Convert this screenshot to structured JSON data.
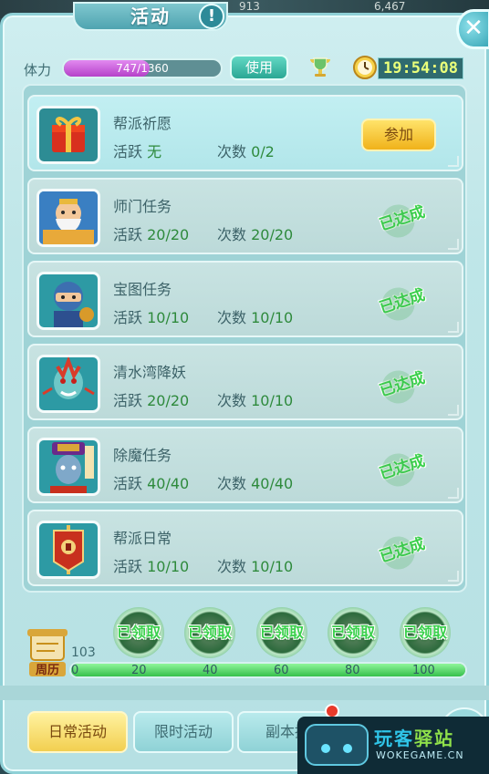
{
  "backdrop": {
    "left_stat": "913",
    "right_stat": "6,467"
  },
  "header": {
    "title": "活动",
    "alert_symbol": "!",
    "close_symbol": "✕"
  },
  "stamina": {
    "label": "体力",
    "current": 747,
    "max": 1360,
    "text": "747/1360",
    "use_label": "使用"
  },
  "clock": {
    "time": "19:54:08"
  },
  "activities": [
    {
      "name": "帮派祈愿",
      "active_label": "活跃",
      "active_value": "无",
      "count_label": "次数",
      "count_value": "0/2",
      "status": "join",
      "button_label": "参加",
      "icon": "gift-icon"
    },
    {
      "name": "师门任务",
      "active_label": "活跃",
      "active_value": "20/20",
      "count_label": "次数",
      "count_value": "20/20",
      "status": "done",
      "stamp_label": "已达成",
      "icon": "elder-master-icon"
    },
    {
      "name": "宝图任务",
      "active_label": "活跃",
      "active_value": "10/10",
      "count_label": "次数",
      "count_value": "10/10",
      "status": "done",
      "stamp_label": "已达成",
      "icon": "ninja-icon"
    },
    {
      "name": "清水湾降妖",
      "active_label": "活跃",
      "active_value": "20/20",
      "count_label": "次数",
      "count_value": "10/10",
      "status": "done",
      "stamp_label": "已达成",
      "icon": "demon-icon"
    },
    {
      "name": "除魔任务",
      "active_label": "活跃",
      "active_value": "40/40",
      "count_label": "次数",
      "count_value": "40/40",
      "status": "done",
      "stamp_label": "已达成",
      "icon": "zombie-official-icon"
    },
    {
      "name": "帮派日常",
      "active_label": "活跃",
      "active_value": "10/10",
      "count_label": "次数",
      "count_value": "10/10",
      "status": "done",
      "stamp_label": "已达成",
      "icon": "guild-banner-icon"
    }
  ],
  "weekly": {
    "label": "周历",
    "score": "103",
    "progress_fraction": 1.0,
    "ticks": [
      "0",
      "20",
      "40",
      "60",
      "80",
      "100"
    ],
    "rewards": [
      "已领取",
      "已领取",
      "已领取",
      "已领取",
      "已领取"
    ]
  },
  "tabs": [
    {
      "label": "日常活动",
      "active": true
    },
    {
      "label": "限时活动",
      "active": false
    },
    {
      "label": "副本挑",
      "active": false
    }
  ],
  "watermark": {
    "title_a": "玩客",
    "title_b": "驿站",
    "subtitle": "WOKEGAME.CN"
  },
  "colors": {
    "accent": "#8fd0d6",
    "done_green": "#39d04a",
    "join_gold": "#f0b21a",
    "stamina_purple": "#b541c9",
    "time_yellow": "#eaff7a"
  }
}
